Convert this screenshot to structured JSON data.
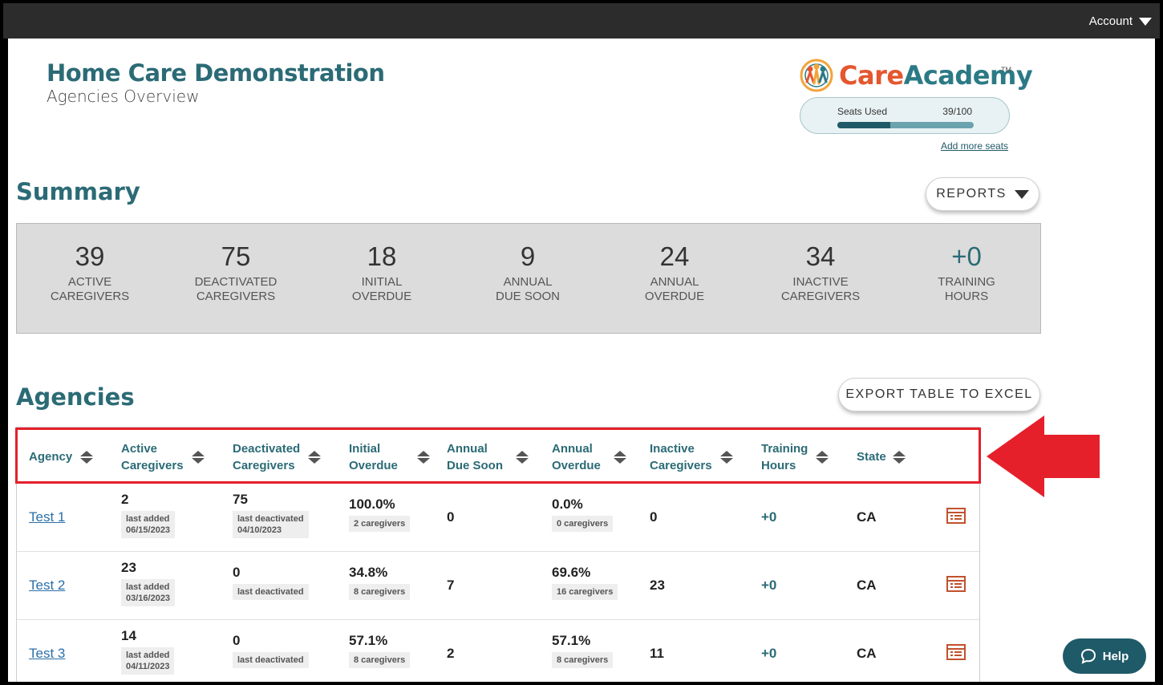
{
  "header": {
    "account_label": "Account"
  },
  "org": {
    "title": "Home Care Demonstration",
    "subtitle": "Agencies Overview"
  },
  "logo": {
    "part1": "Care",
    "part2": "Academy",
    "tm": "TM"
  },
  "seats": {
    "label": "Seats Used",
    "count": "39/100",
    "fill_fraction": 0.39,
    "add_link": "Add more seats"
  },
  "summary": {
    "heading": "Summary",
    "reports_label": "REPORTS",
    "stats": [
      {
        "value": "39",
        "line1": "ACTIVE",
        "line2": "CAREGIVERS"
      },
      {
        "value": "75",
        "line1": "DEACTIVATED",
        "line2": "CAREGIVERS"
      },
      {
        "value": "18",
        "line1": "INITIAL",
        "line2": "OVERDUE"
      },
      {
        "value": "9",
        "line1": "ANNUAL",
        "line2": "DUE SOON"
      },
      {
        "value": "24",
        "line1": "ANNUAL",
        "line2": "OVERDUE"
      },
      {
        "value": "34",
        "line1": "INACTIVE",
        "line2": "CAREGIVERS"
      },
      {
        "value": "+0",
        "line1": "TRAINING",
        "line2": "HOURS"
      }
    ]
  },
  "agencies": {
    "heading": "Agencies",
    "export_label": "EXPORT TABLE TO EXCEL",
    "columns": [
      {
        "line1": "Agency",
        "line2": ""
      },
      {
        "line1": "Active",
        "line2": "Caregivers"
      },
      {
        "line1": "Deactivated",
        "line2": "Caregivers"
      },
      {
        "line1": "Initial",
        "line2": "Overdue"
      },
      {
        "line1": "Annual",
        "line2": "Due Soon"
      },
      {
        "line1": "Annual",
        "line2": "Overdue"
      },
      {
        "line1": "Inactive",
        "line2": "Caregivers"
      },
      {
        "line1": "Training",
        "line2": "Hours"
      },
      {
        "line1": "State",
        "line2": ""
      }
    ],
    "rows": [
      {
        "agency": "Test 1",
        "active": "2",
        "active_sub1": "last added",
        "active_sub2": "06/15/2023",
        "deactivated": "75",
        "deact_sub1": "last deactivated",
        "deact_sub2": "04/10/2023",
        "initial": "100.0%",
        "initial_sub": "2 caregivers",
        "due_soon": "0",
        "annual_overdue": "0.0%",
        "annual_sub": "0 caregivers",
        "inactive": "0",
        "hours": "+0",
        "state": "CA"
      },
      {
        "agency": "Test 2",
        "active": "23",
        "active_sub1": "last added",
        "active_sub2": "03/16/2023",
        "deactivated": "0",
        "deact_sub1": "last deactivated",
        "deact_sub2": "",
        "initial": "34.8%",
        "initial_sub": "8 caregivers",
        "due_soon": "7",
        "annual_overdue": "69.6%",
        "annual_sub": "16 caregivers",
        "inactive": "23",
        "hours": "+0",
        "state": "CA"
      },
      {
        "agency": "Test 3",
        "active": "14",
        "active_sub1": "last added",
        "active_sub2": "04/11/2023",
        "deactivated": "0",
        "deact_sub1": "last deactivated",
        "deact_sub2": "",
        "initial": "57.1%",
        "initial_sub": "8 caregivers",
        "due_soon": "2",
        "annual_overdue": "57.1%",
        "annual_sub": "8 caregivers",
        "inactive": "11",
        "hours": "+0",
        "state": "CA"
      }
    ]
  },
  "help": {
    "label": "Help"
  },
  "colors": {
    "teal": "#2b6b76",
    "dark_teal": "#1f5a68",
    "orange": "#e4572e",
    "highlight_red": "#e5202b",
    "topbar": "#2c2c2c"
  }
}
